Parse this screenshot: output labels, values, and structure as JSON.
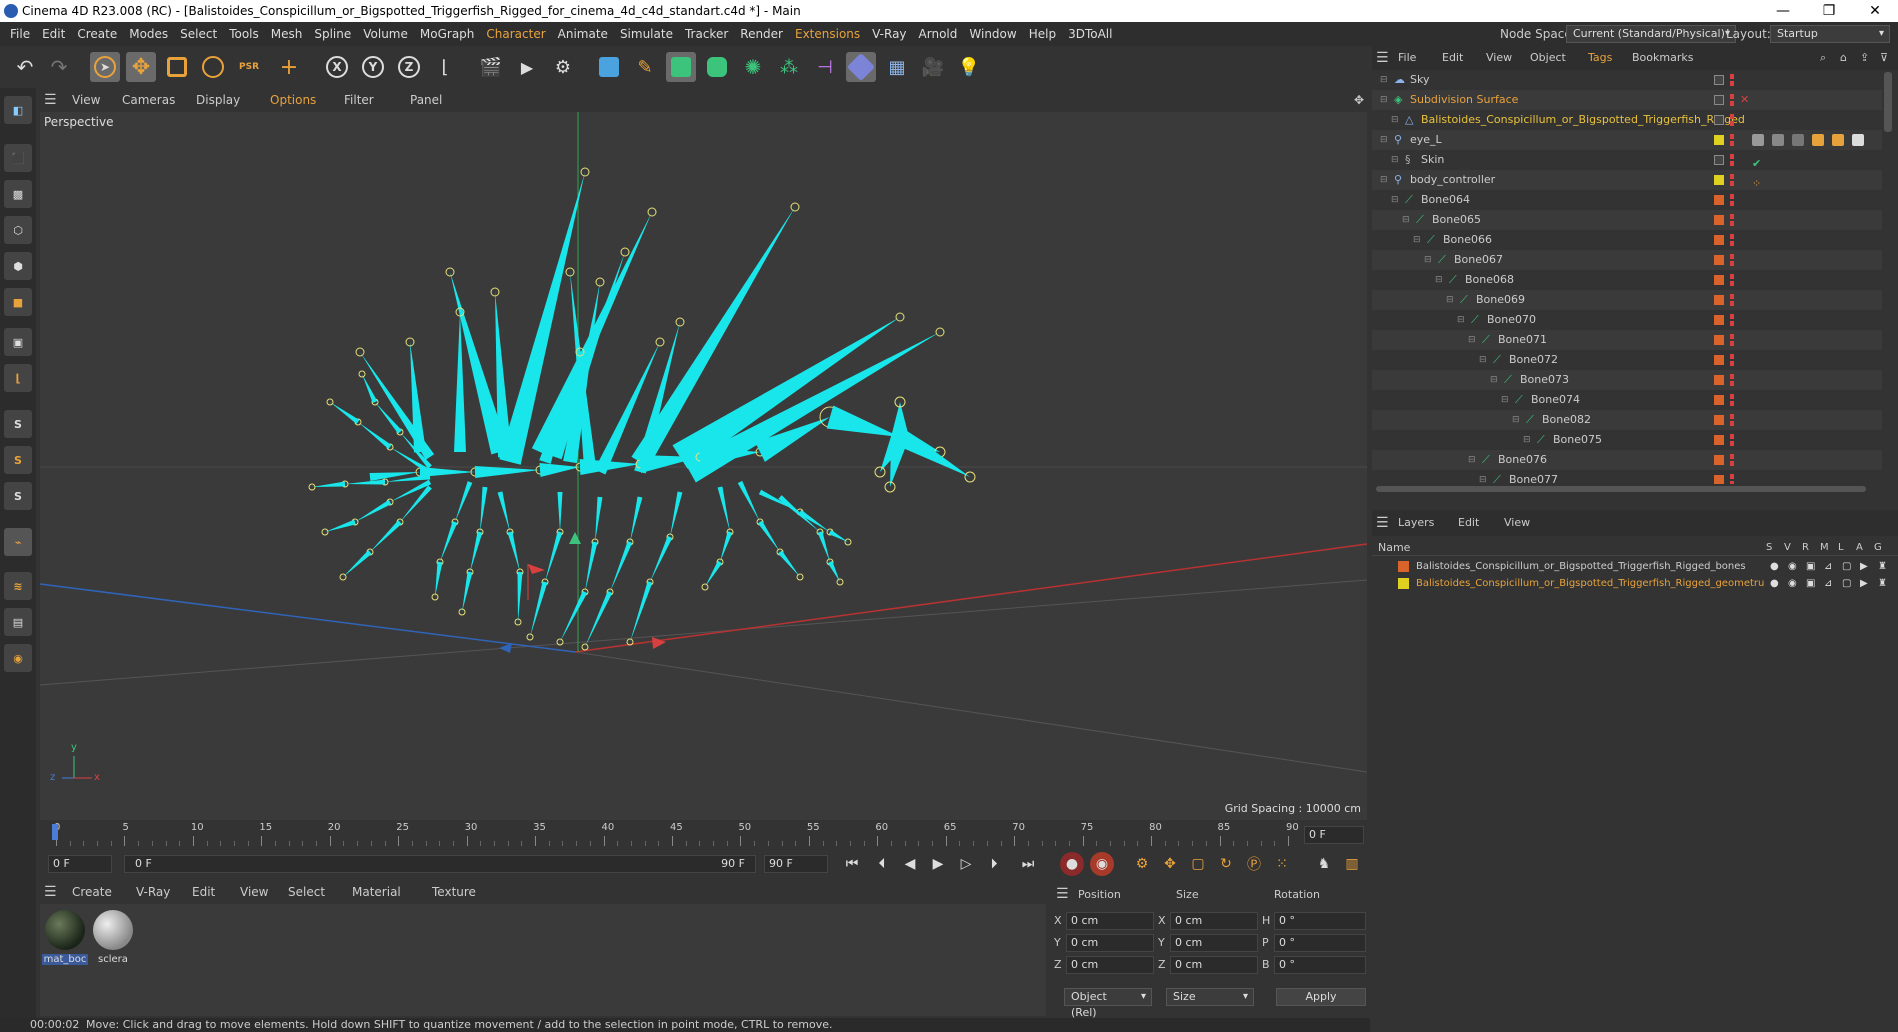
{
  "window": {
    "title": "Cinema 4D R23.008 (RC) - [Balistoides_Conspicillum_or_Bigspotted_Triggerfish_Rigged_for_cinema_4d_c4d_standart.c4d *] - Main",
    "minimize": "—",
    "maximize": "❐",
    "close": "✕"
  },
  "menu": {
    "items": [
      "File",
      "Edit",
      "Create",
      "Modes",
      "Select",
      "Tools",
      "Mesh",
      "Spline",
      "Volume",
      "MoGraph",
      "Character",
      "Animate",
      "Simulate",
      "Tracker",
      "Render",
      "Extensions",
      "V-Ray",
      "Arnold",
      "Window",
      "Help",
      "3DToAll"
    ],
    "node_space_label": "Node Space:",
    "node_space_value": "Current (Standard/Physical)",
    "layout_label": "Layout:",
    "layout_value": "Startup"
  },
  "toolbar": {
    "axis_x": "X",
    "axis_y": "Y",
    "axis_z": "Z"
  },
  "lefttools": {
    "s1": "S",
    "s2": "S",
    "s3": "S"
  },
  "viewport": {
    "menu": [
      "View",
      "Cameras",
      "Display",
      "Options",
      "Filter",
      "Panel"
    ],
    "label": "Perspective",
    "grid_spacing": "Grid Spacing : 10000 cm",
    "axis_y": "y",
    "axis_z": "z",
    "axis_x": "x"
  },
  "timeline": {
    "ticks": [
      "0",
      "5",
      "10",
      "15",
      "20",
      "25",
      "30",
      "35",
      "40",
      "45",
      "50",
      "55",
      "60",
      "65",
      "70",
      "75",
      "80",
      "85",
      "90"
    ],
    "current_frame": "0 F"
  },
  "playbar": {
    "start": "0 F",
    "range_start": "0 F",
    "range_end": "90 F",
    "end": "90 F"
  },
  "materials": {
    "menu": [
      "Create",
      "V-Ray",
      "Edit",
      "View",
      "Select",
      "Material",
      "Texture"
    ],
    "items": [
      {
        "name": "mat_boc"
      },
      {
        "name": "sclera"
      }
    ]
  },
  "coords": {
    "headers": {
      "position": "Position",
      "size": "Size",
      "rotation": "Rotation"
    },
    "rows": [
      {
        "pl": "X",
        "pv": "0 cm",
        "sl": "X",
        "sv": "0 cm",
        "rl": "H",
        "rv": "0 °"
      },
      {
        "pl": "Y",
        "pv": "0 cm",
        "sl": "Y",
        "sv": "0 cm",
        "rl": "P",
        "rv": "0 °"
      },
      {
        "pl": "Z",
        "pv": "0 cm",
        "sl": "Z",
        "sv": "0 cm",
        "rl": "B",
        "rv": "0 °"
      }
    ],
    "mode": "Object (Rel)",
    "size_mode": "Size",
    "apply": "Apply"
  },
  "objects": {
    "menu": [
      "File",
      "Edit",
      "View",
      "Object",
      "Tags",
      "Bookmarks"
    ],
    "rows": [
      {
        "name": "Sky",
        "indent": 0,
        "color": "#cccccc",
        "tag": "",
        "icon": "sky"
      },
      {
        "name": "Subdivision Surface",
        "indent": 0,
        "color": "#e8a23c",
        "tag": "",
        "icon": "subd"
      },
      {
        "name": "Balistoides_Conspicillum_or_Bigspotted_Triggerfish_Rigged",
        "indent": 1,
        "color": "#e8c23c",
        "tag": "",
        "icon": "poly"
      },
      {
        "name": "eye_L",
        "indent": 0,
        "color": "#cccccc",
        "tag": "#e0d020",
        "icon": "null"
      },
      {
        "name": "Skin",
        "indent": 1,
        "color": "#cccccc",
        "tag": "",
        "icon": "skin"
      },
      {
        "name": "body_controller",
        "indent": 0,
        "color": "#cccccc",
        "tag": "#e0d020",
        "icon": "null"
      },
      {
        "name": "Bone064",
        "indent": 1,
        "color": "#cccccc",
        "tag": "#d8642c",
        "icon": "bone"
      },
      {
        "name": "Bone065",
        "indent": 2,
        "color": "#cccccc",
        "tag": "#d8642c",
        "icon": "bone"
      },
      {
        "name": "Bone066",
        "indent": 3,
        "color": "#cccccc",
        "tag": "#d8642c",
        "icon": "bone"
      },
      {
        "name": "Bone067",
        "indent": 4,
        "color": "#cccccc",
        "tag": "#d8642c",
        "icon": "bone"
      },
      {
        "name": "Bone068",
        "indent": 5,
        "color": "#cccccc",
        "tag": "#d8642c",
        "icon": "bone"
      },
      {
        "name": "Bone069",
        "indent": 6,
        "color": "#cccccc",
        "tag": "#d8642c",
        "icon": "bone"
      },
      {
        "name": "Bone070",
        "indent": 7,
        "color": "#cccccc",
        "tag": "#d8642c",
        "icon": "bone"
      },
      {
        "name": "Bone071",
        "indent": 8,
        "color": "#cccccc",
        "tag": "#d8642c",
        "icon": "bone"
      },
      {
        "name": "Bone072",
        "indent": 9,
        "color": "#cccccc",
        "tag": "#d8642c",
        "icon": "bone"
      },
      {
        "name": "Bone073",
        "indent": 10,
        "color": "#cccccc",
        "tag": "#d8642c",
        "icon": "bone"
      },
      {
        "name": "Bone074",
        "indent": 11,
        "color": "#cccccc",
        "tag": "#d8642c",
        "icon": "bone"
      },
      {
        "name": "Bone082",
        "indent": 12,
        "color": "#cccccc",
        "tag": "#d8642c",
        "icon": "bone"
      },
      {
        "name": "Bone075",
        "indent": 13,
        "color": "#cccccc",
        "tag": "#d8642c",
        "icon": "bone"
      },
      {
        "name": "Bone076",
        "indent": 8,
        "color": "#cccccc",
        "tag": "#d8642c",
        "icon": "bone"
      },
      {
        "name": "Bone077",
        "indent": 9,
        "color": "#cccccc",
        "tag": "#d8642c",
        "icon": "bone"
      }
    ]
  },
  "layers": {
    "menu": [
      "Layers",
      "Edit",
      "View"
    ],
    "header": {
      "name": "Name",
      "cols": [
        "S",
        "V",
        "R",
        "M",
        "L",
        "A",
        "G"
      ]
    },
    "rows": [
      {
        "name": "Balistoides_Conspicillum_or_Bigspotted_Triggerfish_Rigged_bones",
        "swatch": "#d8642c",
        "color": "#cccccc"
      },
      {
        "name": "Balistoides_Conspicillum_or_Bigspotted_Triggerfish_Rigged_geometru",
        "swatch": "#e0d020",
        "color": "#e8a23c"
      }
    ]
  },
  "status": {
    "time": "00:00:02",
    "message": "Move: Click and drag to move elements. Hold down SHIFT to quantize movement / add to the selection in point mode, CTRL to remove."
  },
  "colors": {
    "rig": "#19e6ea",
    "joint": "#e6e07a",
    "accent": "#e8a23c"
  }
}
